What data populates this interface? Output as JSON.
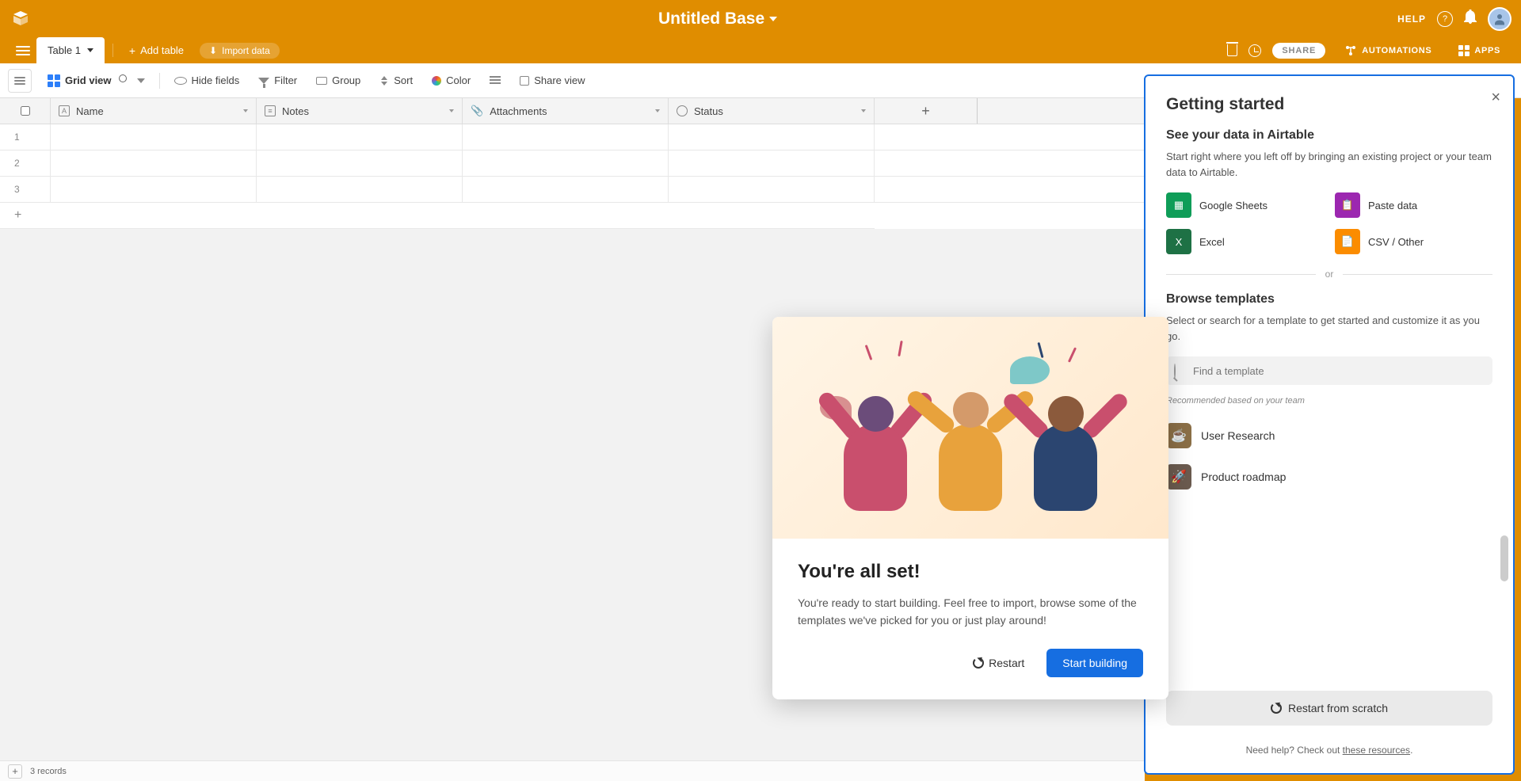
{
  "header": {
    "base_title": "Untitled Base",
    "help_label": "HELP"
  },
  "tabs": {
    "table1": "Table 1",
    "add_table": "Add table",
    "import_data": "Import data",
    "share": "SHARE",
    "automations": "AUTOMATIONS",
    "apps": "APPS"
  },
  "viewbar": {
    "view_name": "Grid view",
    "hide_fields": "Hide fields",
    "filter": "Filter",
    "group": "Group",
    "sort": "Sort",
    "color": "Color",
    "share_view": "Share view"
  },
  "grid": {
    "columns": [
      {
        "label": "Name",
        "icon": "A"
      },
      {
        "label": "Notes",
        "icon": "≡"
      },
      {
        "label": "Attachments",
        "icon": "📎"
      },
      {
        "label": "Status",
        "icon": "◯"
      }
    ],
    "rows": [
      "1",
      "2",
      "3"
    ],
    "footer_records": "3 records"
  },
  "sidebar": {
    "title": "Getting started",
    "sec1_h": "See your data in Airtable",
    "sec1_p": "Start right where you left off by bringing an existing project or your team data to Airtable.",
    "imports": {
      "sheets": "Google Sheets",
      "paste": "Paste data",
      "excel": "Excel",
      "csv": "CSV / Other"
    },
    "or": "or",
    "sec2_h": "Browse templates",
    "sec2_p": "Select or search for a template to get started and customize it as you go.",
    "search_placeholder": "Find a template",
    "rec_label": "Recommended based on your team",
    "templates": {
      "ur": "User Research",
      "pr": "Product roadmap"
    },
    "restart": "Restart from scratch",
    "help_prefix": "Need help? Check out ",
    "help_link": "these resources",
    "help_suffix": "."
  },
  "modal": {
    "title": "You're all set!",
    "body": "You're ready to start building. Feel free to import, browse some of the templates we've picked for you or just play around!",
    "restart": "Restart",
    "start": "Start building"
  }
}
